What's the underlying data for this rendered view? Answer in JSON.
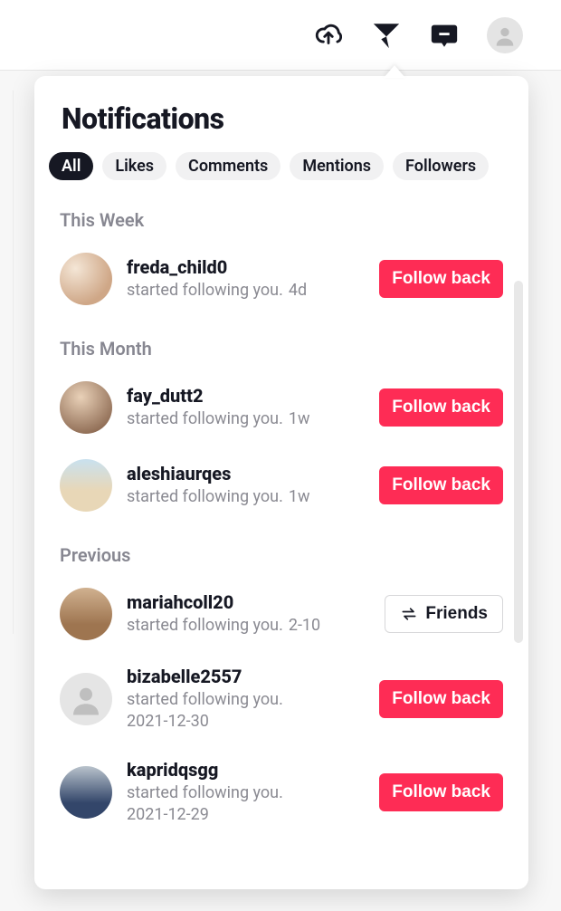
{
  "title": "Notifications",
  "tabs": [
    {
      "label": "All",
      "active": true
    },
    {
      "label": "Likes",
      "active": false
    },
    {
      "label": "Comments",
      "active": false
    },
    {
      "label": "Mentions",
      "active": false
    },
    {
      "label": "Followers",
      "active": false
    }
  ],
  "buttons": {
    "follow_back": "Follow back",
    "friends": "Friends"
  },
  "sections": [
    {
      "header": "This Week",
      "items": [
        {
          "username": "freda_child0",
          "action": "started following you.",
          "time": "4d",
          "button": "follow_back",
          "avatar": "a"
        }
      ]
    },
    {
      "header": "This Month",
      "items": [
        {
          "username": "fay_dutt2",
          "action": "started following you.",
          "time": "1w",
          "button": "follow_back",
          "avatar": "b"
        },
        {
          "username": "aleshiaurqes",
          "action": "started following you.",
          "time": "1w",
          "button": "follow_back",
          "avatar": "c"
        }
      ]
    },
    {
      "header": "Previous",
      "items": [
        {
          "username": "mariahcoll20",
          "action": "started following you.",
          "time": "2-10",
          "button": "friends",
          "avatar": "d"
        },
        {
          "username": "bizabelle2557",
          "action": "started following you.",
          "time": "2021-12-30",
          "time_block": true,
          "button": "follow_back",
          "avatar": "e",
          "placeholder": true
        },
        {
          "username": "kapridqsgg",
          "action": "started following you.",
          "time": "2021-12-29",
          "time_block": true,
          "button": "follow_back",
          "avatar": "f"
        }
      ]
    }
  ]
}
